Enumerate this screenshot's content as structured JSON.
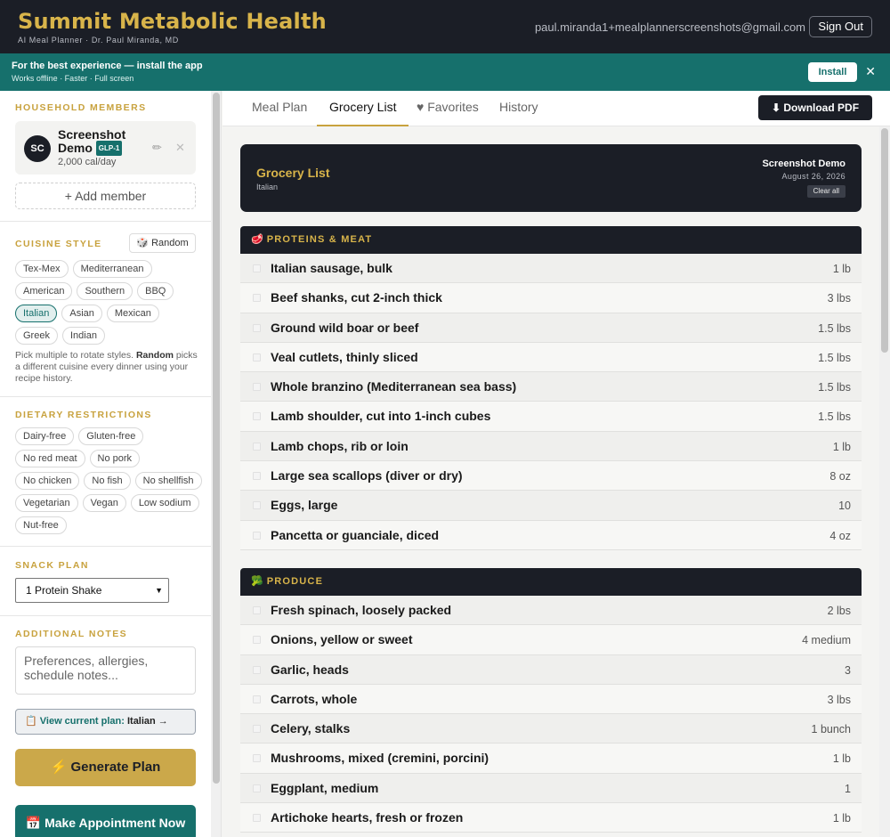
{
  "header": {
    "brand": "Summit Metabolic Health",
    "subtitle": "AI Meal Planner · Dr. Paul Miranda, MD",
    "email": "paul.miranda1+mealplannerscreenshots@gmail.com",
    "signout_label": "Sign Out"
  },
  "install_banner": {
    "title": "For the best experience — install the app",
    "subtitle": "Works offline · Faster · Full screen",
    "install_label": "Install",
    "close_glyph": "✕"
  },
  "sidebar": {
    "household_title": "HOUSEHOLD MEMBERS",
    "member": {
      "initials": "SC",
      "name": "Screenshot Demo",
      "badge": "GLP-1",
      "calories": "2,000 cal/day",
      "edit_glyph": "✏",
      "remove_glyph": "✕"
    },
    "add_member_label": "+ Add member",
    "cuisine_title": "CUISINE STYLE",
    "random_label": "🎲 Random",
    "cuisines": [
      {
        "label": "Tex-Mex",
        "active": false
      },
      {
        "label": "Mediterranean",
        "active": false
      },
      {
        "label": "American",
        "active": false
      },
      {
        "label": "Southern",
        "active": false
      },
      {
        "label": "BBQ",
        "active": false
      },
      {
        "label": "Italian",
        "active": true
      },
      {
        "label": "Asian",
        "active": false
      },
      {
        "label": "Mexican",
        "active": false
      },
      {
        "label": "Greek",
        "active": false
      },
      {
        "label": "Indian",
        "active": false
      }
    ],
    "cuisine_hint_pre": "Pick multiple to rotate styles. ",
    "cuisine_hint_bold": "Random",
    "cuisine_hint_post": " picks a different cuisine every dinner using your recipe history.",
    "dietary_title": "DIETARY RESTRICTIONS",
    "dietary": [
      "Dairy-free",
      "Gluten-free",
      "No red meat",
      "No pork",
      "No chicken",
      "No fish",
      "No shellfish",
      "Vegetarian",
      "Vegan",
      "Low sodium",
      "Nut-free"
    ],
    "snack_title": "SNACK PLAN",
    "snack_value": "1 Protein Shake",
    "notes_title": "ADDITIONAL NOTES",
    "notes_placeholder": "Preferences, allergies, schedule notes...",
    "view_plan_label": "📋 View current plan: ",
    "view_plan_name": "Italian →",
    "generate_label": "⚡ Generate Plan",
    "appointment_label": "📅 Make Appointment Now"
  },
  "tabs": {
    "meal_plan": "Meal Plan",
    "grocery_list": "Grocery List",
    "favorites": "♥ Favorites",
    "history": "History",
    "active": "grocery_list"
  },
  "download_label": "⬇ Download PDF",
  "grocery": {
    "title": "Grocery List",
    "cuisine": "Italian",
    "name": "Screenshot Demo",
    "date": "August 26, 2026",
    "clear_label": "Clear all",
    "categories": [
      {
        "icon": "🥩",
        "title": "PROTEINS & MEAT",
        "items": [
          {
            "name": "Italian sausage, bulk",
            "qty": "1 lb"
          },
          {
            "name": "Beef shanks, cut 2-inch thick",
            "qty": "3 lbs"
          },
          {
            "name": "Ground wild boar or beef",
            "qty": "1.5 lbs"
          },
          {
            "name": "Veal cutlets, thinly sliced",
            "qty": "1.5 lbs"
          },
          {
            "name": "Whole branzino (Mediterranean sea bass)",
            "qty": "1.5 lbs"
          },
          {
            "name": "Lamb shoulder, cut into 1-inch cubes",
            "qty": "1.5 lbs"
          },
          {
            "name": "Lamb chops, rib or loin",
            "qty": "1 lb"
          },
          {
            "name": "Large sea scallops (diver or dry)",
            "qty": "8 oz"
          },
          {
            "name": "Eggs, large",
            "qty": "10"
          },
          {
            "name": "Pancetta or guanciale, diced",
            "qty": "4 oz"
          }
        ]
      },
      {
        "icon": "🥦",
        "title": "PRODUCE",
        "items": [
          {
            "name": "Fresh spinach, loosely packed",
            "qty": "2 lbs"
          },
          {
            "name": "Onions, yellow or sweet",
            "qty": "4 medium"
          },
          {
            "name": "Garlic, heads",
            "qty": "3"
          },
          {
            "name": "Carrots, whole",
            "qty": "3 lbs"
          },
          {
            "name": "Celery, stalks",
            "qty": "1 bunch"
          },
          {
            "name": "Mushrooms, mixed (cremini, porcini)",
            "qty": "1 lb"
          },
          {
            "name": "Eggplant, medium",
            "qty": "1"
          },
          {
            "name": "Artichoke hearts, fresh or frozen",
            "qty": "1 lb"
          }
        ]
      }
    ]
  },
  "colors": {
    "dark": "#1b1e26",
    "gold": "#c8a23e",
    "teal": "#16706c"
  }
}
